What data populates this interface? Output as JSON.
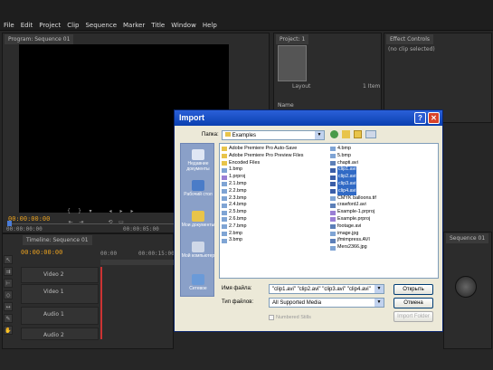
{
  "menu": [
    "File",
    "Edit",
    "Project",
    "Clip",
    "Sequence",
    "Marker",
    "Title",
    "Window",
    "Help"
  ],
  "left_monitor": {
    "tab": "Program: Sequence 01",
    "timecode": "00:00:00:00",
    "tc2": "00:00:00:00",
    "tc3": "00:00:05:00"
  },
  "project": {
    "tab": "Project: 1",
    "line1": "1 Item",
    "label": "Layout",
    "name": "Name"
  },
  "effect_controls": {
    "tab": "Effect Controls",
    "msg": "(no clip selected)"
  },
  "timeline": {
    "tab": "Timeline: Sequence 01",
    "timecode": "00:00:00:00",
    "ruler1": "00:00",
    "ruler2": "00:00:15:00",
    "tracks": [
      "Video 2",
      "Video 1",
      "Audio 1",
      "Audio 2"
    ]
  },
  "right_panel": {
    "tab": "Sequence 01"
  },
  "dialog": {
    "title": "Import",
    "lookin_label": "Папка:",
    "lookin_value": "Examples",
    "places": [
      "Недавние документы",
      "Рабочий стол",
      "Мои документы",
      "Мой компьютер",
      "Сетевое"
    ],
    "files_col1": [
      {
        "name": "Adobe Premiere Pro Auto-Save",
        "icon": "folder"
      },
      {
        "name": "Adobe Premiere Pro Preview Files",
        "icon": "folder"
      },
      {
        "name": "Encoded Files",
        "icon": "folder"
      },
      {
        "name": "1.bmp",
        "icon": "img"
      },
      {
        "name": "1.prproj",
        "icon": "proj"
      },
      {
        "name": "2.1.bmp",
        "icon": "img"
      },
      {
        "name": "2.2.bmp",
        "icon": "img"
      },
      {
        "name": "2.3.bmp",
        "icon": "img"
      },
      {
        "name": "2.4.bmp",
        "icon": "img"
      },
      {
        "name": "2.5.bmp",
        "icon": "img"
      },
      {
        "name": "2.6.bmp",
        "icon": "img"
      },
      {
        "name": "2.7.bmp",
        "icon": "img"
      },
      {
        "name": "2.bmp",
        "icon": "img"
      },
      {
        "name": "3.bmp",
        "icon": "img"
      }
    ],
    "files_col2": [
      {
        "name": "4.bmp",
        "icon": "img",
        "sel": false
      },
      {
        "name": "5.bmp",
        "icon": "img",
        "sel": false
      },
      {
        "name": "chapti.avi",
        "icon": "vid",
        "sel": false
      },
      {
        "name": "clip1.avi",
        "icon": "sel",
        "sel": true
      },
      {
        "name": "clip2.avi",
        "icon": "sel",
        "sel": true
      },
      {
        "name": "clip3.avi",
        "icon": "sel",
        "sel": true
      },
      {
        "name": "clip4.avi",
        "icon": "sel",
        "sel": true
      },
      {
        "name": "CMYK balloons.tif",
        "icon": "img",
        "sel": false
      },
      {
        "name": "crawfordJ.avi",
        "icon": "vid",
        "sel": false
      },
      {
        "name": "Example-1.prproj",
        "icon": "proj",
        "sel": false
      },
      {
        "name": "Example.prproj",
        "icon": "proj",
        "sel": false
      },
      {
        "name": "footage.avi",
        "icon": "vid",
        "sel": false
      },
      {
        "name": "image.jpg",
        "icon": "img",
        "sel": false
      },
      {
        "name": "jfmimpress.AVI",
        "icon": "vid",
        "sel": false
      },
      {
        "name": "Mers2366.jpg",
        "icon": "img",
        "sel": false
      }
    ],
    "filename_label": "Имя файла:",
    "filename_value": "\"clip1.avi\" \"clip2.avi\" \"clip3.avi\" \"clip4.avi\"",
    "filetype_label": "Тип файлов:",
    "filetype_value": "All Supported Media",
    "open_button": "Открыть",
    "cancel_button": "Отмена",
    "import_folder_button": "Import Folder",
    "numbered_label": "Numbered Stills"
  }
}
